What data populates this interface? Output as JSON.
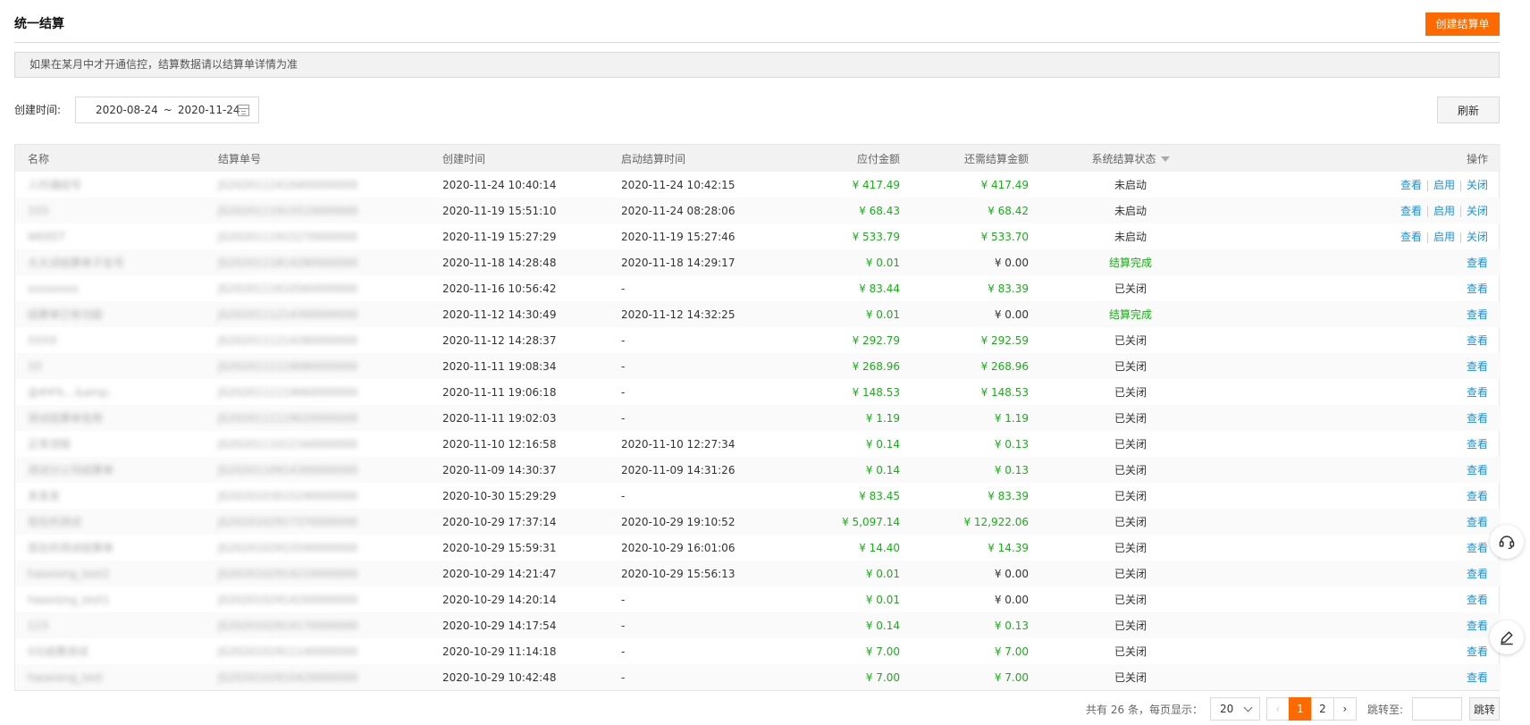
{
  "header": {
    "title": "统一结算",
    "create_button": "创建结算单"
  },
  "notice": "如果在某月中才开通信控，结算数据请以结算单详情为准",
  "filter": {
    "label": "创建时间:",
    "date_start": "2020-08-24",
    "date_sep": "~",
    "date_end": "2020-11-24",
    "refresh_button": "刷新"
  },
  "table": {
    "headers": {
      "name": "名称",
      "order_no": "结算单号",
      "created": "创建时间",
      "started": "启动结算时间",
      "payable": "应付金额",
      "remaining": "还需结算金额",
      "status": "系统结算状态",
      "ops": "操作"
    },
    "ops_labels": {
      "view": "查看",
      "enable": "启用",
      "close": "关闭"
    },
    "rows": [
      {
        "name": "人时通结号",
        "order_no": "JS2020112410400000000",
        "created": "2020-11-24 10:40:14",
        "started": "2020-11-24 10:42:15",
        "payable": "¥ 417.49",
        "remaining": "¥ 417.49",
        "status": "未启动",
        "status_green": false,
        "full_ops": true,
        "remaining_green": true
      },
      {
        "name": "333",
        "order_no": "JS2020111915510000000",
        "created": "2020-11-19 15:51:10",
        "started": "2020-11-24 08:28:06",
        "payable": "¥ 68.43",
        "remaining": "¥ 68.42",
        "status": "未启动",
        "status_green": false,
        "full_ops": true,
        "remaining_green": true
      },
      {
        "name": "WEEET",
        "order_no": "JS2020111915270000000",
        "created": "2020-11-19 15:27:29",
        "started": "2020-11-19 15:27:46",
        "payable": "¥ 533.79",
        "remaining": "¥ 533.70",
        "status": "未启动",
        "status_green": false,
        "full_ops": true,
        "remaining_green": true
      },
      {
        "name": "大大试结算单子名号",
        "order_no": "JS2020111814280000000",
        "created": "2020-11-18 14:28:48",
        "started": "2020-11-18 14:29:17",
        "payable": "¥ 0.01",
        "remaining": "¥ 0.00",
        "status": "结算完成",
        "status_green": true,
        "full_ops": false,
        "remaining_green": false
      },
      {
        "name": "xxxxxxxx",
        "order_no": "JS2020111610560000000",
        "created": "2020-11-16 10:56:42",
        "started": "-",
        "payable": "¥ 83.44",
        "remaining": "¥ 83.39",
        "status": "已关闭",
        "status_green": false,
        "full_ops": false,
        "remaining_green": true
      },
      {
        "name": "结算单已有功能",
        "order_no": "JS2020111214300000000",
        "created": "2020-11-12 14:30:49",
        "started": "2020-11-12 14:32:25",
        "payable": "¥ 0.01",
        "remaining": "¥ 0.00",
        "status": "结算完成",
        "status_green": true,
        "full_ops": false,
        "remaining_green": false
      },
      {
        "name": "XXXX",
        "order_no": "JS2020111214280000000",
        "created": "2020-11-12 14:28:37",
        "started": "-",
        "payable": "¥ 292.79",
        "remaining": "¥ 292.59",
        "status": "已关闭",
        "status_green": false,
        "full_ops": false,
        "remaining_green": true
      },
      {
        "name": "33",
        "order_no": "JS2020111119080000000",
        "created": "2020-11-11 19:08:34",
        "started": "-",
        "payable": "¥ 268.96",
        "remaining": "¥ 268.96",
        "status": "已关闭",
        "status_green": false,
        "full_ops": false,
        "remaining_green": true
      },
      {
        "name": "@#¥%…&amp;",
        "order_no": "JS2020111119060000000",
        "created": "2020-11-11 19:06:18",
        "started": "-",
        "payable": "¥ 148.53",
        "remaining": "¥ 148.53",
        "status": "已关闭",
        "status_green": false,
        "full_ops": false,
        "remaining_green": true
      },
      {
        "name": "测试结算单名称",
        "order_no": "JS2020111119020000000",
        "created": "2020-11-11 19:02:03",
        "started": "-",
        "payable": "¥ 1.19",
        "remaining": "¥ 1.19",
        "status": "已关闭",
        "status_green": false,
        "full_ops": false,
        "remaining_green": true
      },
      {
        "name": "正常流程",
        "order_no": "JS2020111012160000000",
        "created": "2020-11-10 12:16:58",
        "started": "2020-11-10 12:27:34",
        "payable": "¥ 0.14",
        "remaining": "¥ 0.13",
        "status": "已关闭",
        "status_green": false,
        "full_ops": false,
        "remaining_green": true
      },
      {
        "name": "测试分公司结算单",
        "order_no": "JS2020110914300000000",
        "created": "2020-11-09 14:30:37",
        "started": "2020-11-09 14:31:26",
        "payable": "¥ 0.14",
        "remaining": "¥ 0.13",
        "status": "已关闭",
        "status_green": false,
        "full_ops": false,
        "remaining_green": true
      },
      {
        "name": "发发发",
        "order_no": "JS2020103015290000000",
        "created": "2020-10-30 15:29:29",
        "started": "-",
        "payable": "¥ 83.45",
        "remaining": "¥ 83.39",
        "status": "已关闭",
        "status_green": false,
        "full_ops": false,
        "remaining_green": true
      },
      {
        "name": "现在的测试",
        "order_no": "JS2020102917370000000",
        "created": "2020-10-29 17:37:14",
        "started": "2020-10-29 19:10:52",
        "payable": "¥ 5,097.14",
        "remaining": "¥ 12,922.06",
        "status": "已关闭",
        "status_green": false,
        "full_ops": false,
        "remaining_green": true
      },
      {
        "name": "现在的测试结算单",
        "order_no": "JS2020102915590000000",
        "created": "2020-10-29 15:59:31",
        "started": "2020-10-29 16:01:06",
        "payable": "¥ 14.40",
        "remaining": "¥ 14.39",
        "status": "已关闭",
        "status_green": false,
        "full_ops": false,
        "remaining_green": true
      },
      {
        "name": "haoxiong_test2",
        "order_no": "JS2020102914210000000",
        "created": "2020-10-29 14:21:47",
        "started": "2020-10-29 15:56:13",
        "payable": "¥ 0.01",
        "remaining": "¥ 0.00",
        "status": "已关闭",
        "status_green": false,
        "full_ops": false,
        "remaining_green": false
      },
      {
        "name": "haoxiong_test1",
        "order_no": "JS2020102914200000000",
        "created": "2020-10-29 14:20:14",
        "started": "-",
        "payable": "¥ 0.01",
        "remaining": "¥ 0.00",
        "status": "已关闭",
        "status_green": false,
        "full_ops": false,
        "remaining_green": false
      },
      {
        "name": "123",
        "order_no": "JS2020102914170000000",
        "created": "2020-10-29 14:17:54",
        "started": "-",
        "payable": "¥ 0.14",
        "remaining": "¥ 0.13",
        "status": "已关闭",
        "status_green": false,
        "full_ops": false,
        "remaining_green": true
      },
      {
        "name": "0元结算测试",
        "order_no": "JS2020102911140000000",
        "created": "2020-10-29 11:14:18",
        "started": "-",
        "payable": "¥ 7.00",
        "remaining": "¥ 7.00",
        "status": "已关闭",
        "status_green": false,
        "full_ops": false,
        "remaining_green": true
      },
      {
        "name": "haoxiong_test",
        "order_no": "JS2020102910420000000",
        "created": "2020-10-29 10:42:48",
        "started": "-",
        "payable": "¥ 7.00",
        "remaining": "¥ 7.00",
        "status": "已关闭",
        "status_green": false,
        "full_ops": false,
        "remaining_green": true
      }
    ]
  },
  "pager": {
    "total": "共有 26 条，每页显示：",
    "page_size": "20",
    "prev": "‹",
    "pages": [
      "1",
      "2"
    ],
    "next": "›",
    "jump_label": "跳转至:",
    "jump_button": "跳转"
  },
  "colors": {
    "accent": "#ff6a00",
    "link": "#1e90d8",
    "money_green": "#1aad19"
  },
  "icons": {
    "date": "calendar-icon",
    "status_filter": "filter-icon",
    "float_support": "headset-icon",
    "float_edit": "edit-icon"
  }
}
